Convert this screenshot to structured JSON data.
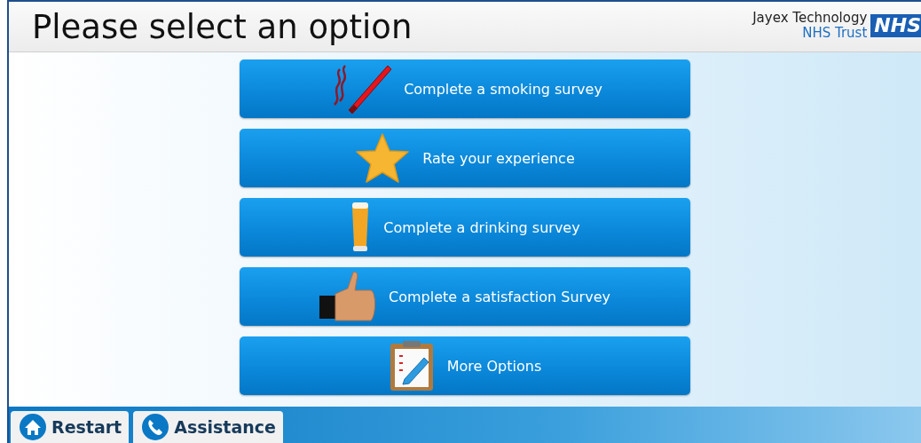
{
  "header": {
    "title": "Please select an option",
    "org_line_1": "Jayex Technology",
    "org_line_2": "NHS Trust",
    "logo": "NHS"
  },
  "options": [
    {
      "label": "Complete a smoking survey",
      "kind": "cigarette"
    },
    {
      "label": "Rate your experience",
      "kind": "star"
    },
    {
      "label": "Complete a drinking survey",
      "kind": "beer"
    },
    {
      "label": "Complete a satisfaction Survey",
      "kind": "thumb"
    },
    {
      "label": "More Options",
      "kind": "clipboard"
    }
  ],
  "footer": [
    {
      "label": "Restart",
      "kind": "home"
    },
    {
      "label": "Assistance",
      "kind": "phone"
    }
  ]
}
